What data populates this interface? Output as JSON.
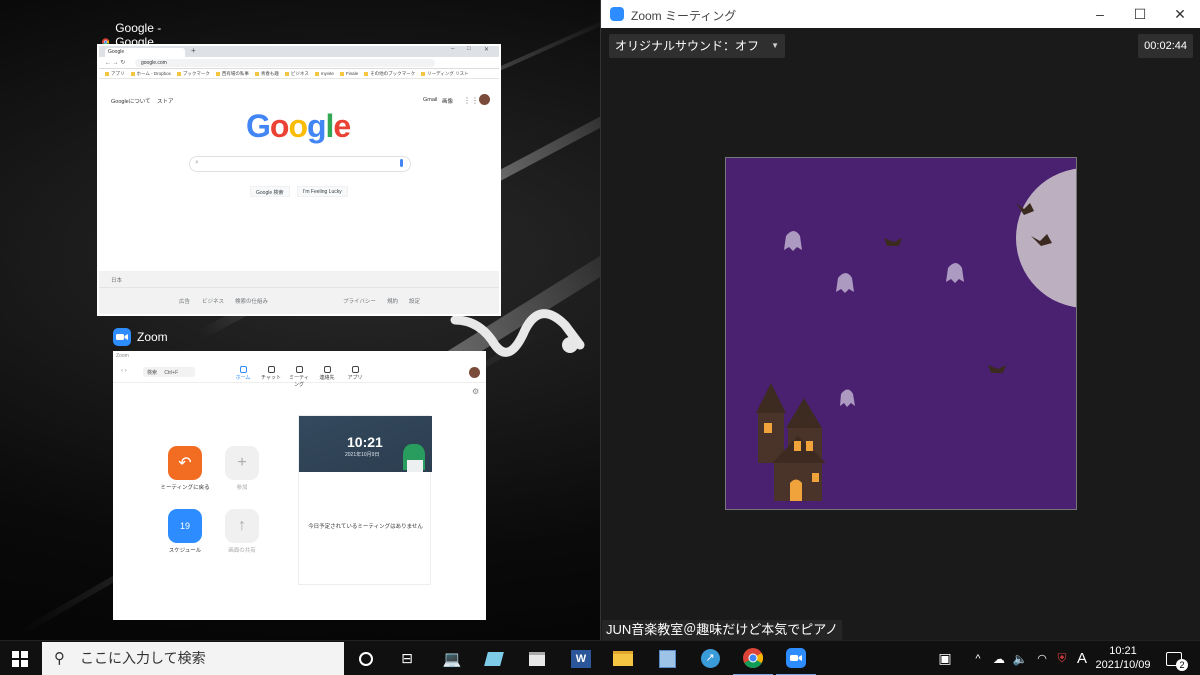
{
  "chrome_window": {
    "title": "Google - Google Chrome",
    "tab_label": "Google",
    "url": "google.com",
    "bookmarks": [
      "アプリ",
      "ホーム - Dropbox",
      "ブックマーク",
      "西有場の私事",
      "青春も趣",
      "ビジネス",
      "myvite",
      "Finale",
      "その他のブックマーク",
      "リーディング リスト"
    ],
    "google_about": "Googleについて",
    "google_store": "ストア",
    "gmail": "Gmail",
    "images": "画像",
    "logo_text": "Google",
    "search_button": "Google 検索",
    "lucky_button": "I'm Feeling Lucky",
    "country": "日本",
    "footer_links_left": [
      "広告",
      "ビジネス",
      "検索の仕組み"
    ],
    "footer_links_right": [
      "プライバシー",
      "規約",
      "設定"
    ]
  },
  "zoom_window": {
    "title": "Zoom",
    "app_title": "Zoom",
    "search_placeholder": "検索",
    "search_shortcut": "Ctrl+F",
    "nav": [
      "ホーム",
      "チャット",
      "ミーティング",
      "連絡先",
      "アプリ"
    ],
    "actions": [
      "ミーティングに戻る",
      "参加",
      "スケジュール",
      "画面の共有"
    ],
    "calendar_icon_day": "19",
    "clock_time": "10:21",
    "clock_date": "2021年10月9日",
    "no_meetings": "今日予定されているミーティングはありません"
  },
  "meeting_window": {
    "title": "Zoom ミーティング",
    "original_sound": "オリジナルサウンド：オフ",
    "elapsed": "00:02:44",
    "participant_name": "JUN音楽教室＠趣味だけど本気でピアノ"
  },
  "taskbar": {
    "search_placeholder": "ここに入力して検索",
    "ime": "A",
    "time": "10:21",
    "date": "2021/10/09",
    "notification_count": "2"
  },
  "colors": {
    "zoom_blue": "#2d8cff",
    "zoom_orange": "#f26d21",
    "halloween_purple": "#4a2170"
  }
}
